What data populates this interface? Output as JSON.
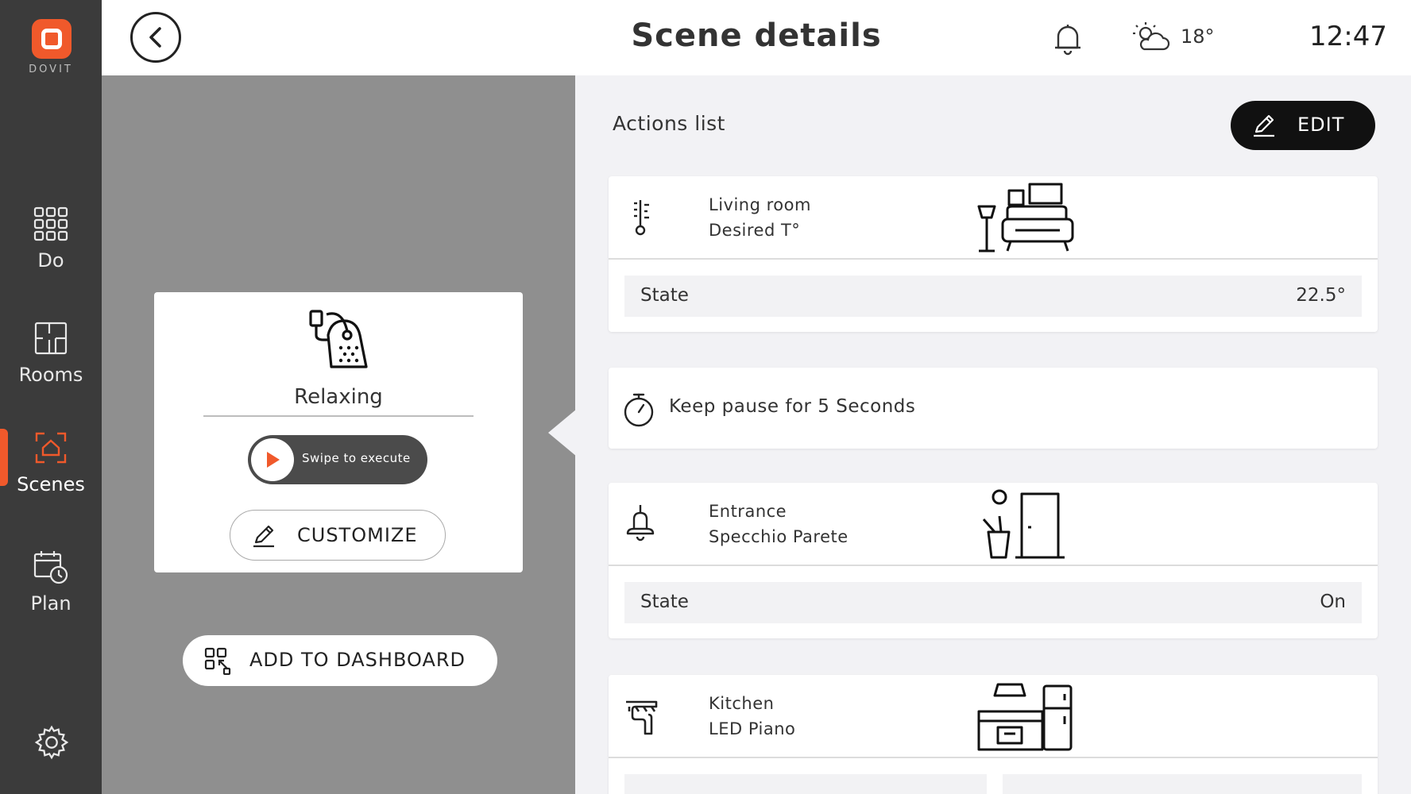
{
  "sidebar": {
    "logo_text": "DOVIT",
    "items": [
      {
        "label": "Do",
        "icon": "grid-icon"
      },
      {
        "label": "Rooms",
        "icon": "floorplan-icon"
      },
      {
        "label": "Scenes",
        "icon": "scenes-home-icon",
        "active": true
      },
      {
        "label": "Plan",
        "icon": "calendar-clock-icon"
      }
    ],
    "settings_icon": "gear-icon"
  },
  "header": {
    "title": "Scene details",
    "temperature": "18°",
    "time": "12:47"
  },
  "scene": {
    "name": "Relaxing",
    "swipe_label": "Swipe to execute",
    "customize_label": "CUSTOMIZE",
    "add_dashboard_label": "ADD TO DASHBOARD"
  },
  "actions": {
    "title": "Actions list",
    "edit_label": "EDIT",
    "items": [
      {
        "room": "Living room",
        "device": "Desired T°",
        "state_label": "State",
        "state_value": "22.5°"
      },
      {
        "pause_text": "Keep pause for 5 Seconds"
      },
      {
        "room": "Entrance",
        "device": "Specchio Parete",
        "state_label": "State",
        "state_value": "On"
      },
      {
        "room": "Kitchen",
        "device": "LED Piano"
      }
    ]
  },
  "colors": {
    "accent": "#f0592b",
    "sidebar": "#3b3b3b",
    "panel_bg": "#f2f2f5",
    "left_bg": "#8f8f8f"
  }
}
